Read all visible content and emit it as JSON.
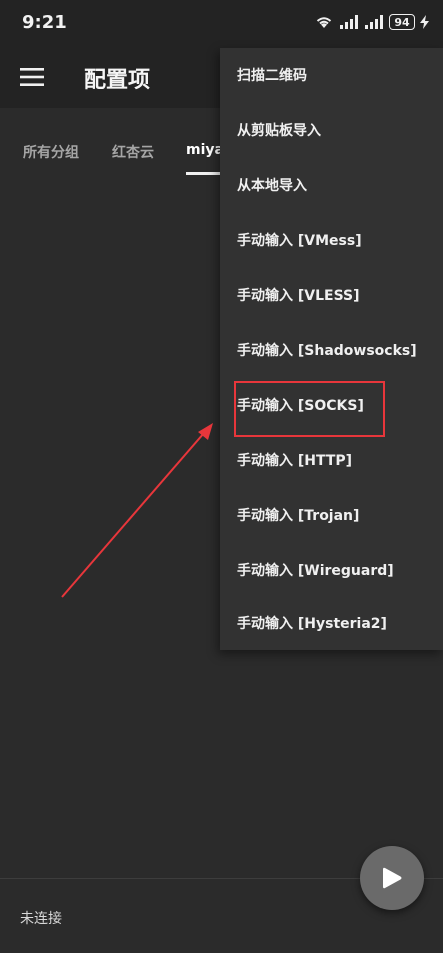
{
  "status_bar": {
    "time": "9:21",
    "icons": [
      "wifi-icon",
      "signal-icon",
      "signal-icon"
    ],
    "battery_level": "94",
    "charging_icon": "bolt-icon"
  },
  "app_bar": {
    "menu_icon": "hamburger-menu-icon",
    "title": "配置项"
  },
  "tabs": [
    {
      "label": "所有分组",
      "active": false
    },
    {
      "label": "红杏云",
      "active": false
    },
    {
      "label": "miya",
      "active": true
    }
  ],
  "dropdown_menu": {
    "items": [
      {
        "label": "扫描二维码"
      },
      {
        "label": "从剪贴板导入"
      },
      {
        "label": "从本地导入"
      },
      {
        "label": "手动输入 [VMess]"
      },
      {
        "label": "手动输入 [VLESS]"
      },
      {
        "label": "手动输入 [Shadowsocks]"
      },
      {
        "label": "手动输入 [SOCKS]",
        "highlighted": true
      },
      {
        "label": "手动输入 [HTTP]"
      },
      {
        "label": "手动输入 [Trojan]"
      },
      {
        "label": "手动输入 [Wireguard]"
      },
      {
        "label": "手动输入 [Hysteria2]"
      }
    ]
  },
  "footer": {
    "connection_status": "未连接"
  },
  "fab": {
    "icon": "play-icon"
  },
  "colors": {
    "background": "#2b2b2b",
    "app_bar": "#232323",
    "menu_background": "#323232",
    "annotation_red": "#e8363b",
    "fab": "#6a6a6a"
  }
}
